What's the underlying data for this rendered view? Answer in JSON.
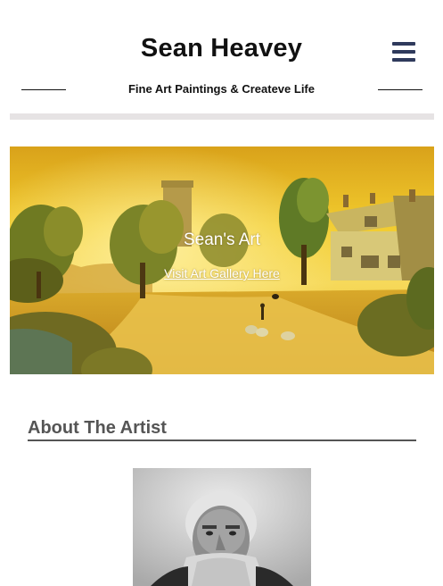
{
  "header": {
    "site_title": "Sean Heavey",
    "tagline": "Fine Art Paintings & Createve Life",
    "menu_icon": "hamburger-menu-icon",
    "menu_color": "#2f3a5c"
  },
  "hero": {
    "title": "Sean's Art",
    "link_label": "Visit Art Gallery Here",
    "image": "landscape painting of a golden village road with trees, cottage, church tower and sheep"
  },
  "about": {
    "heading": "About The Artist",
    "portrait_image": "black and white portrait of a bearded elderly man"
  },
  "colors": {
    "divider_bar": "#e6e3e4",
    "heading_text": "#555555"
  }
}
